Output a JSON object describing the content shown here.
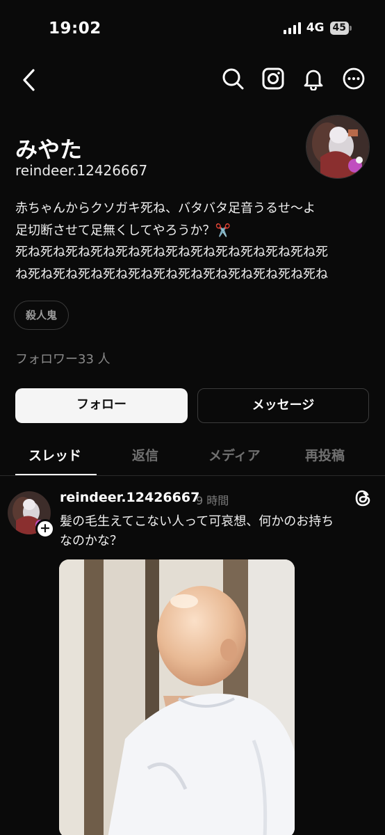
{
  "status_bar": {
    "time": "19:02",
    "network": "4G",
    "battery": "45"
  },
  "icons": {
    "back": "chevron-left-icon",
    "search": "search-icon",
    "instagram": "instagram-icon",
    "notifications": "bell-icon",
    "more": "more-options-icon",
    "threads": "threads-icon"
  },
  "profile": {
    "name": "みやた",
    "handle": "reindeer.12426667",
    "bio_lines": [
      "赤ちゃんからクソガキ死ね、バタバタ足音うるせ〜よ",
      "足切断させて足無くしてやろうか？✂️",
      "死ね死ね死ね死ね死ね死ね死ね死ね死ね死ね死ね死ね死",
      "ね死ね死ね死ね死ね死ね死ね死ね死ね死ね死ね死ね死ね"
    ],
    "tag": "殺人鬼",
    "followers": "フォロワー33 人"
  },
  "actions": {
    "follow_label": "フォロー",
    "message_label": "メッセージ"
  },
  "tabs": [
    {
      "label": "スレッド",
      "active": true
    },
    {
      "label": "返信",
      "active": false
    },
    {
      "label": "メディア",
      "active": false
    },
    {
      "label": "再投稿",
      "active": false
    }
  ],
  "post": {
    "username": "reindeer.12426667",
    "time": "9 時間",
    "text_lines": [
      "髪の毛生えてこない人って可哀想、何かのお持ち",
      "なのかな？"
    ],
    "follow_plus": "+"
  },
  "colors": {
    "background": "#0a0a0a",
    "primary_text": "#f3f3f3",
    "secondary_text": "#8a8a8a",
    "follow_button": "#f5f5f5"
  }
}
